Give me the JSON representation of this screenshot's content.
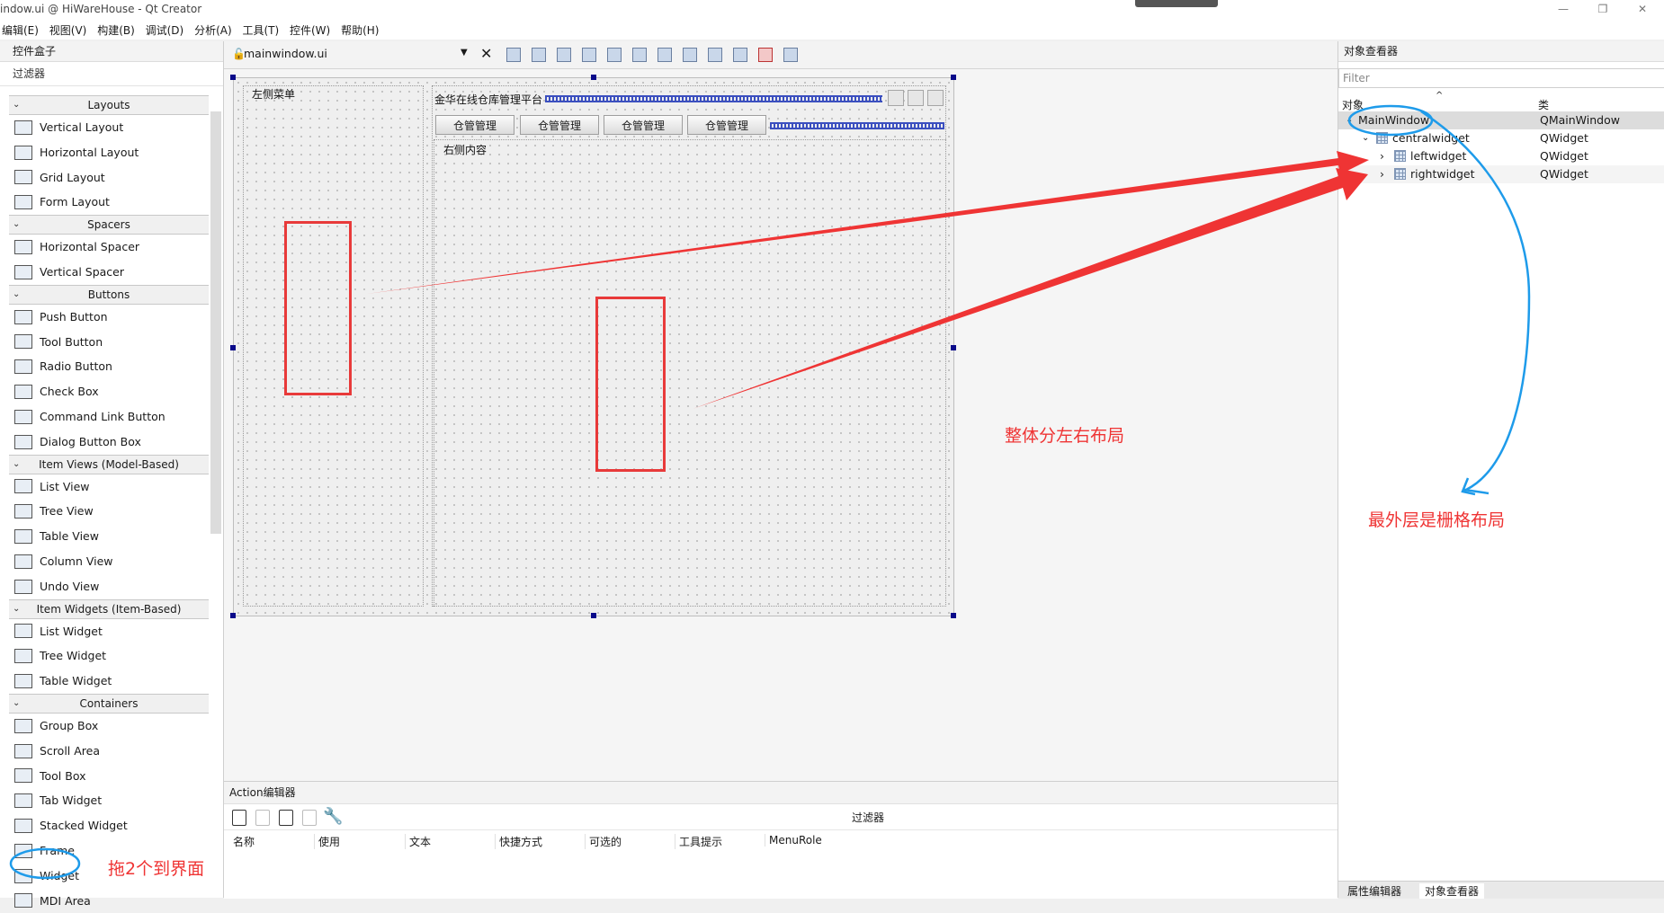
{
  "window": {
    "title": "indow.ui @ HiWareHouse - Qt Creator",
    "controls": [
      "—",
      "❐",
      "✕"
    ]
  },
  "menu": [
    "编辑(E)",
    "视图(V)",
    "构建(B)",
    "调试(D)",
    "分析(A)",
    "工具(T)",
    "控件(W)",
    "帮助(H)"
  ],
  "widget_box": {
    "title": "控件盒子",
    "filter_label": "过滤器",
    "categories": [
      {
        "name": "Layouts",
        "items": [
          "Vertical Layout",
          "Horizontal Layout",
          "Grid Layout",
          "Form Layout"
        ]
      },
      {
        "name": "Spacers",
        "items": [
          "Horizontal Spacer",
          "Vertical Spacer"
        ]
      },
      {
        "name": "Buttons",
        "items": [
          "Push Button",
          "Tool Button",
          "Radio Button",
          "Check Box",
          "Command Link Button",
          "Dialog Button Box"
        ]
      },
      {
        "name": "Item Views (Model-Based)",
        "items": [
          "List View",
          "Tree View",
          "Table View",
          "Column View",
          "Undo View"
        ]
      },
      {
        "name": "Item Widgets (Item-Based)",
        "items": [
          "List Widget",
          "Tree Widget",
          "Table Widget"
        ]
      },
      {
        "name": "Containers",
        "items": [
          "Group Box",
          "Scroll Area",
          "Tool Box",
          "Tab Widget",
          "Stacked Widget",
          "Frame",
          "Widget",
          "MDI Area"
        ]
      }
    ]
  },
  "editor": {
    "document": "mainwindow.ui"
  },
  "form": {
    "left_label": "左侧菜单",
    "platform_title": "金华在线仓库管理平台",
    "buttons": [
      "仓管管理",
      "仓管管理",
      "仓管管理",
      "仓管管理"
    ],
    "right_label": "右侧内容"
  },
  "action_editor": {
    "title": "Action编辑器",
    "filter_label": "过滤器",
    "columns": [
      "名称",
      "使用",
      "文本",
      "快捷方式",
      "可选的",
      "工具提示",
      "MenuRole"
    ]
  },
  "object_inspector": {
    "title": "对象查看器",
    "filter_placeholder": "Filter",
    "col_object": "对象",
    "col_class": "类",
    "rows": [
      {
        "name": "MainWindow",
        "class": "QMainWindow"
      },
      {
        "name": "centralwidget",
        "class": "QWidget"
      },
      {
        "name": "leftwidget",
        "class": "QWidget"
      },
      {
        "name": "rightwidget",
        "class": "QWidget"
      }
    ],
    "tabs": [
      "属性编辑器",
      "对象查看器"
    ]
  },
  "annotations": {
    "left_right_layout": "整体分左右布局",
    "outer_grid_layout": "最外层是栅格布局",
    "drag_two": "拖2个到界面"
  },
  "colors": {
    "annotation_red": "#ef3434",
    "annotation_blue": "#1e9bea",
    "spacer_blue": "#3b4fbf"
  }
}
